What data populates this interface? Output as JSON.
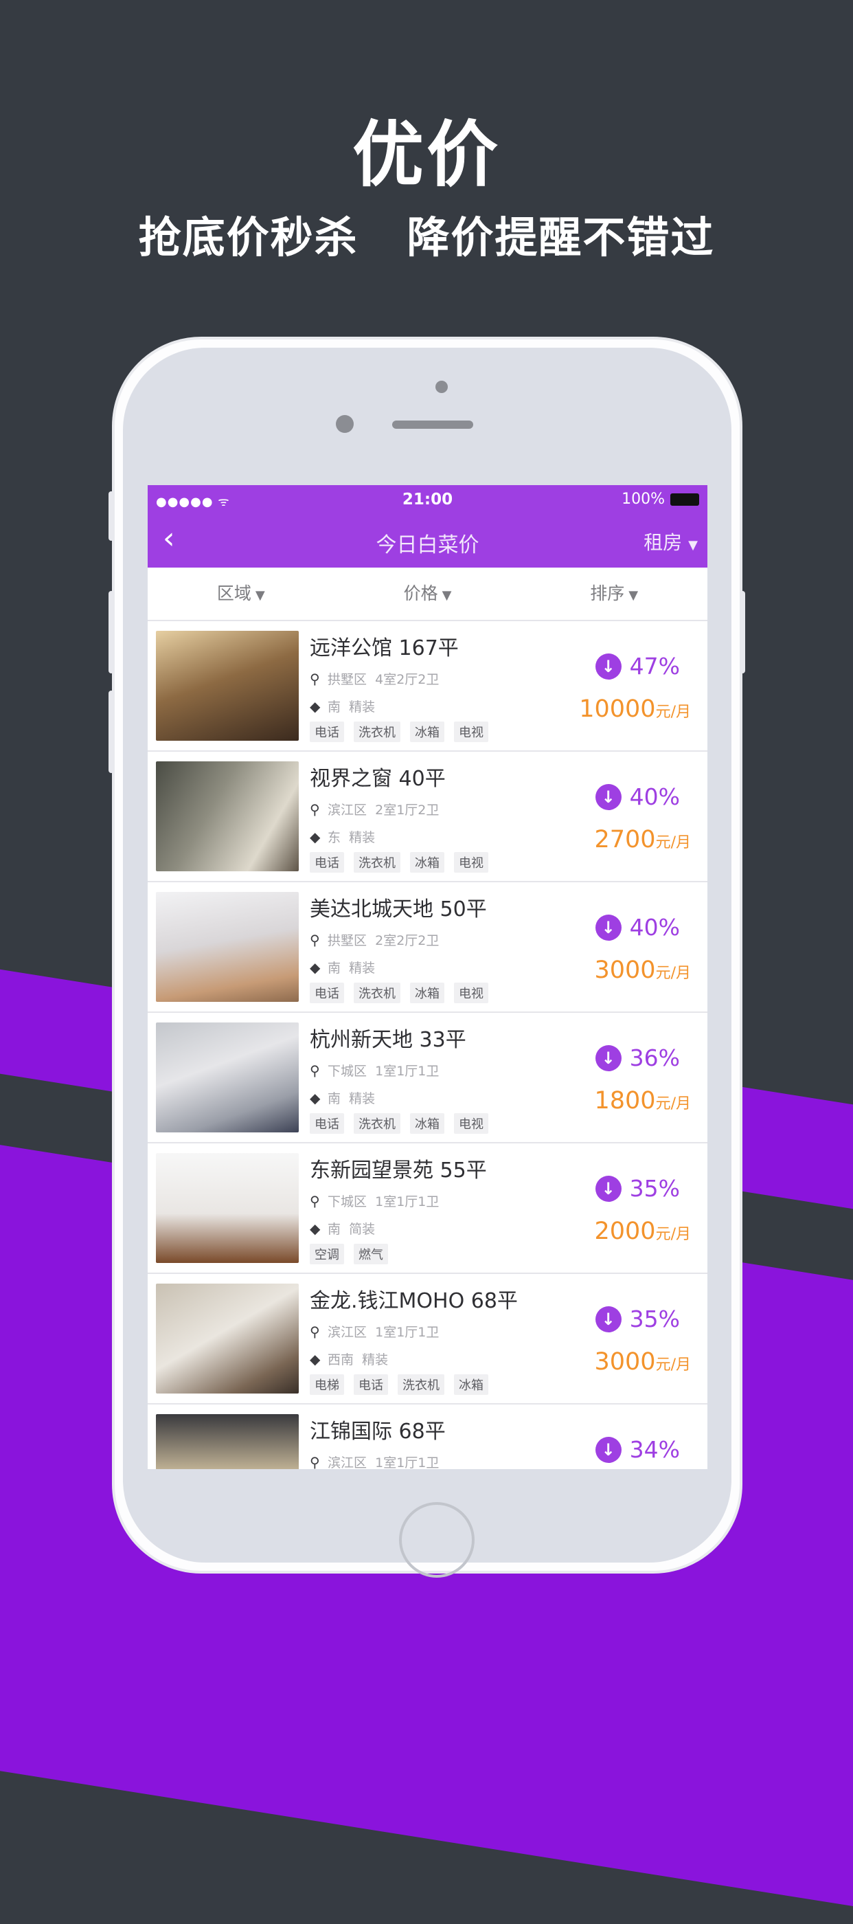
{
  "hero": {
    "title": "优价",
    "subtitle": "抢底价秒杀   降价提醒不错过"
  },
  "status_bar": {
    "signal": "●●●●● ᯤ",
    "time": "21:00",
    "battery": "100%"
  },
  "navbar": {
    "back": "‹",
    "title": "今日白菜价",
    "right": "租房",
    "right_arrow": "▼"
  },
  "filters": [
    {
      "label": "区域",
      "arrow": "▼"
    },
    {
      "label": "价格",
      "arrow": "▼"
    },
    {
      "label": "排序",
      "arrow": "▼"
    }
  ],
  "icons": {
    "location": "location-pin-icon",
    "tag": "tag-icon",
    "drop": "down-arrow-circle-icon"
  },
  "icon_glyphs": {
    "location": "⚲",
    "tag": "◆",
    "drop": "↓"
  },
  "colors": {
    "accent": "#9e3fe2",
    "price": "#f3932c",
    "background": "#363b42",
    "band": "#8a14dc"
  },
  "listings": [
    {
      "name": "远洋公馆 167平",
      "district": "拱墅区",
      "layout": "4室2厅2卫",
      "orientation": "南",
      "decoration": "精装",
      "tags": [
        "电话",
        "洗衣机",
        "冰箱",
        "电视"
      ],
      "drop": "47%",
      "price": "10000",
      "unit": "元/月"
    },
    {
      "name": "视界之窗 40平",
      "district": "滨江区",
      "layout": "2室1厅2卫",
      "orientation": "东",
      "decoration": "精装",
      "tags": [
        "电话",
        "洗衣机",
        "冰箱",
        "电视"
      ],
      "drop": "40%",
      "price": "2700",
      "unit": "元/月"
    },
    {
      "name": "美达北城天地 50平",
      "district": "拱墅区",
      "layout": "2室2厅2卫",
      "orientation": "南",
      "decoration": "精装",
      "tags": [
        "电话",
        "洗衣机",
        "冰箱",
        "电视"
      ],
      "drop": "40%",
      "price": "3000",
      "unit": "元/月"
    },
    {
      "name": "杭州新天地 33平",
      "district": "下城区",
      "layout": "1室1厅1卫",
      "orientation": "南",
      "decoration": "精装",
      "tags": [
        "电话",
        "洗衣机",
        "冰箱",
        "电视"
      ],
      "drop": "36%",
      "price": "1800",
      "unit": "元/月"
    },
    {
      "name": "东新园望景苑 55平",
      "district": "下城区",
      "layout": "1室1厅1卫",
      "orientation": "南",
      "decoration": "简装",
      "tags": [
        "空调",
        "燃气"
      ],
      "drop": "35%",
      "price": "2000",
      "unit": "元/月"
    },
    {
      "name": "金龙.钱江MOHO 68平",
      "district": "滨江区",
      "layout": "1室1厅1卫",
      "orientation": "西南",
      "decoration": "精装",
      "tags": [
        "电梯",
        "电话",
        "洗衣机",
        "冰箱"
      ],
      "drop": "35%",
      "price": "3000",
      "unit": "元/月"
    },
    {
      "name": "江锦国际 68平",
      "district": "滨江区",
      "layout": "1室1厅1卫",
      "orientation": "",
      "decoration": "",
      "tags": [],
      "drop": "34%",
      "price": "",
      "unit": ""
    }
  ]
}
